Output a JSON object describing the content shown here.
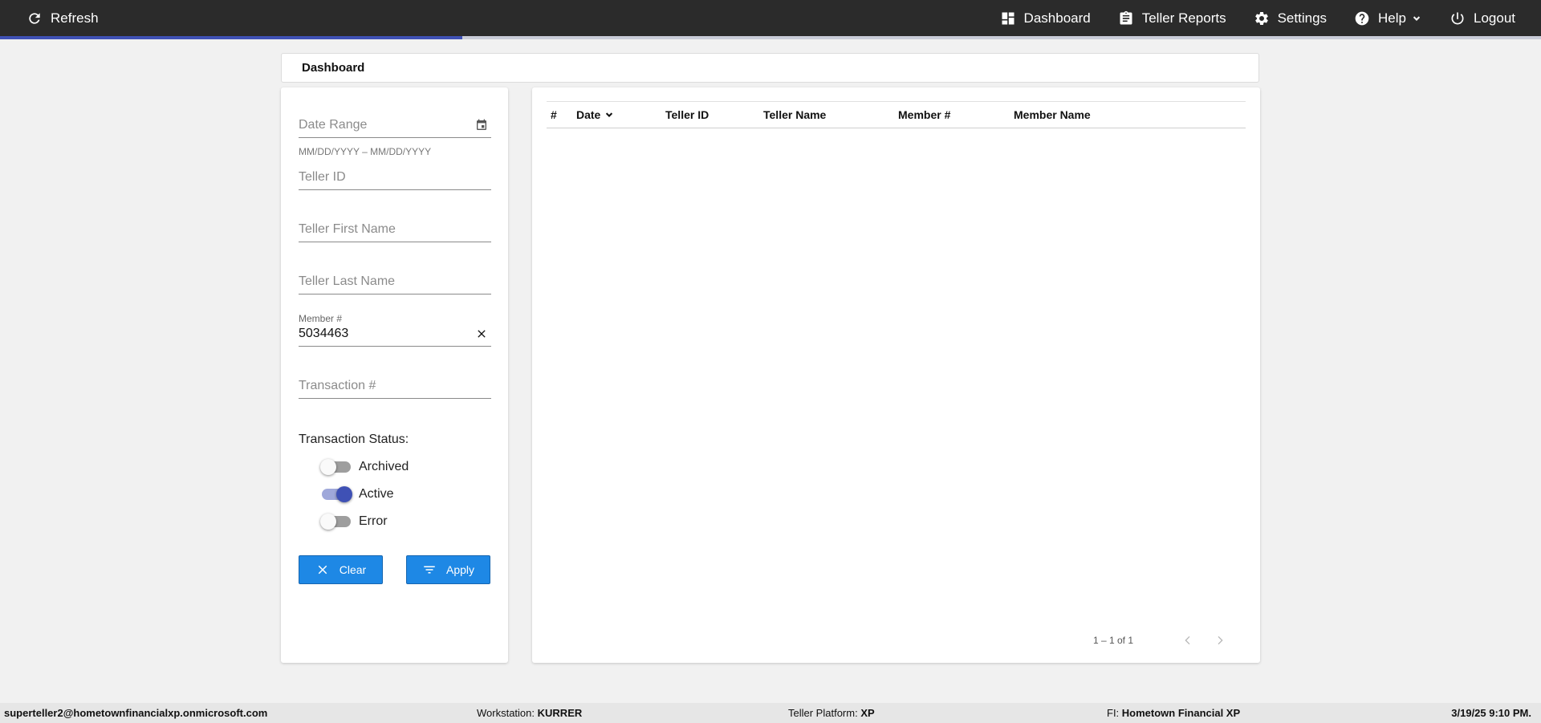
{
  "topbar": {
    "refresh_label": "Refresh",
    "nav": [
      {
        "label": "Dashboard",
        "icon": "dashboard-icon"
      },
      {
        "label": "Teller Reports",
        "icon": "clipboard-icon"
      },
      {
        "label": "Settings",
        "icon": "gear-icon"
      },
      {
        "label": "Help",
        "icon": "help-circle-icon"
      },
      {
        "label": "Logout",
        "icon": "power-icon"
      }
    ],
    "accent": "#3f51b5",
    "background": "#2b2b2b",
    "load_progress": 0.3
  },
  "page": {
    "title": "Dashboard"
  },
  "filters": {
    "date_range": {
      "placeholder": "Date Range",
      "hint": "MM/DD/YYYY – MM/DD/YYYY"
    },
    "teller_id": {
      "placeholder": "Teller ID"
    },
    "teller_first_name": {
      "placeholder": "Teller First Name"
    },
    "teller_last_name": {
      "placeholder": "Teller Last Name"
    },
    "member_number": {
      "label": "Member #",
      "value": "5034463"
    },
    "transaction_number": {
      "placeholder": "Transaction #"
    },
    "status_label": "Transaction Status:",
    "statuses": [
      {
        "label": "Archived",
        "on": false
      },
      {
        "label": "Active",
        "on": true
      },
      {
        "label": "Error",
        "on": false
      }
    ],
    "clear_label": "Clear",
    "apply_label": "Apply",
    "button_color": "#1e88e5"
  },
  "table": {
    "columns": [
      "#",
      "Date",
      "Teller ID",
      "Teller Name",
      "Member #",
      "Member Name"
    ],
    "sort_column": "Date",
    "rows": [],
    "range_label": "1 – 1 of 1"
  },
  "footer": {
    "user_email": "superteller2@hometownfinancialxp.onmicrosoft.com",
    "workstation_label": "Workstation:",
    "workstation_value": "KURRER",
    "platform_label": "Teller Platform:",
    "platform_value": "XP",
    "fi_label": "FI:",
    "fi_value": "Hometown Financial XP",
    "datetime": "3/19/25 9:10 PM."
  }
}
